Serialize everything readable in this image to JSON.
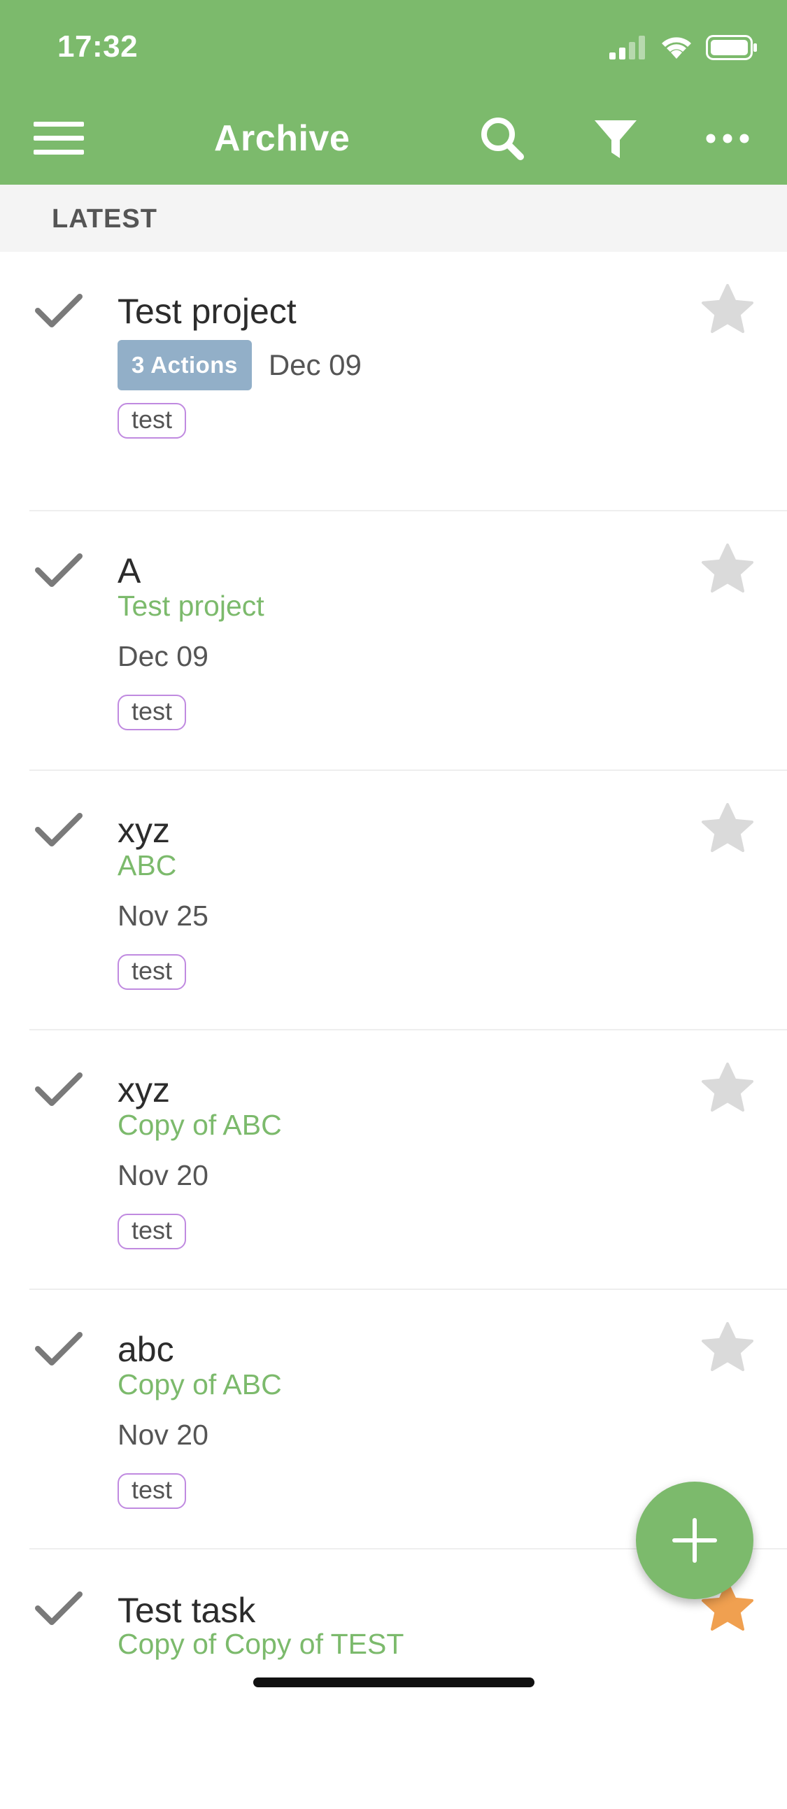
{
  "status_bar": {
    "time": "17:32",
    "icons": [
      "signal-icon",
      "wifi-icon",
      "battery-icon"
    ]
  },
  "app_bar": {
    "title": "Archive",
    "icons": [
      "menu-icon",
      "search-icon",
      "filter-icon",
      "more-icon"
    ]
  },
  "section": {
    "label": "LATEST"
  },
  "items": [
    {
      "title": "Test project",
      "badge": "3 Actions",
      "date": "Dec 09",
      "tag": "test"
    },
    {
      "title": "A",
      "project": "Test project",
      "date": "Dec 09",
      "tag": "test"
    },
    {
      "title": "xyz",
      "project": "ABC",
      "date": "Nov 25",
      "tag": "test"
    },
    {
      "title": "xyz",
      "project": "Copy of ABC",
      "date": "Nov 20",
      "tag": "test"
    },
    {
      "title": "abc",
      "project": "Copy of ABC",
      "date": "Nov 20",
      "tag": "test"
    },
    {
      "title": "Test task",
      "project": "Copy of Copy of TEST"
    }
  ],
  "colors": {
    "accent": "#7cba6c",
    "badge": "#92afc8",
    "tag_border": "#c08ae0",
    "icon_gray": "#7a7a7a",
    "star_gray": "#dadada"
  }
}
